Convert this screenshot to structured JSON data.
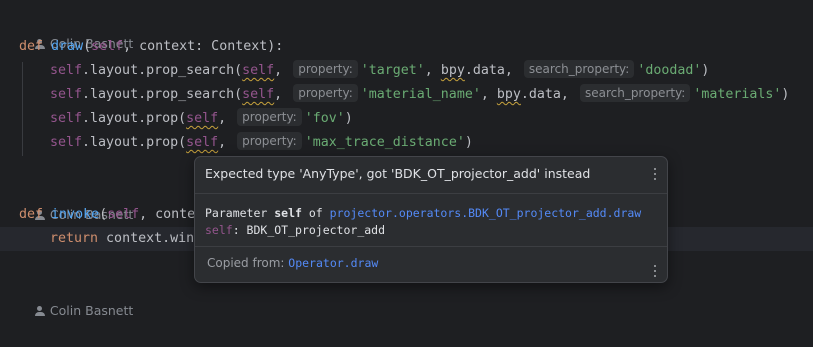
{
  "authors": {
    "a1": "Colin Basnett",
    "a2": "Colin Basnett",
    "a3": "Colin Basnett"
  },
  "code": {
    "l1": {
      "kw": "def",
      "fn": "draw",
      "p1": "(",
      "self": "self",
      "rest": ", context: Context):"
    },
    "l2": {
      "self": "self",
      "a": ".layout.prop_search(",
      "self2": "self",
      "c": ",",
      "hint1": "property:",
      "s1": "'target'",
      "b": ", ",
      "bpy": "bpy",
      "d": ".data,",
      "hint2": "search_property:",
      "s2": "'doodad'",
      "e": ")"
    },
    "l3": {
      "self": "self",
      "a": ".layout.prop_search(",
      "self2": "self",
      "c": ",",
      "hint1": "property:",
      "s1": "'material_name'",
      "b": ", ",
      "bpy": "bpy",
      "d": ".data,",
      "hint2": "search_property:",
      "s2": "'materials'",
      "e": ")"
    },
    "l4": {
      "self": "self",
      "a": ".layout.prop(",
      "self2": "self",
      "c": ",",
      "hint1": "property:",
      "s1": "'fov'",
      "e": ")"
    },
    "l5": {
      "self": "self",
      "a": ".layout.prop(",
      "self2": "self",
      "c": ",",
      "hint1": "property:",
      "s1": "'max_trace_distance'",
      "e": ")"
    },
    "l6": {
      "kw": "def",
      "fn": "invoke",
      "p1": "(",
      "self": "self",
      "rest": ", conte"
    },
    "l7": {
      "kw": "return",
      "rest": " context.win"
    }
  },
  "popup": {
    "message": "Expected type 'AnyType', got 'BDK_OT_projector_add' instead",
    "doc_prefix": "Parameter ",
    "doc_param": "self",
    "doc_of": " of ",
    "doc_link": "projector.operators.BDK_OT_projector_add.draw",
    "doc_self": "self",
    "doc_type": ": BDK_OT_projector_add",
    "footer_label": "Copied from: ",
    "footer_link": "Operator.draw"
  },
  "icons": {
    "author": "person-icon",
    "menu": "more-vertical-icon"
  },
  "colors": {
    "background": "#1e1f22",
    "keyword": "#cf8e6d",
    "function": "#56a8f5",
    "self": "#94558d",
    "string": "#6aab73",
    "link": "#548af7",
    "warning": "#c7a23c"
  }
}
